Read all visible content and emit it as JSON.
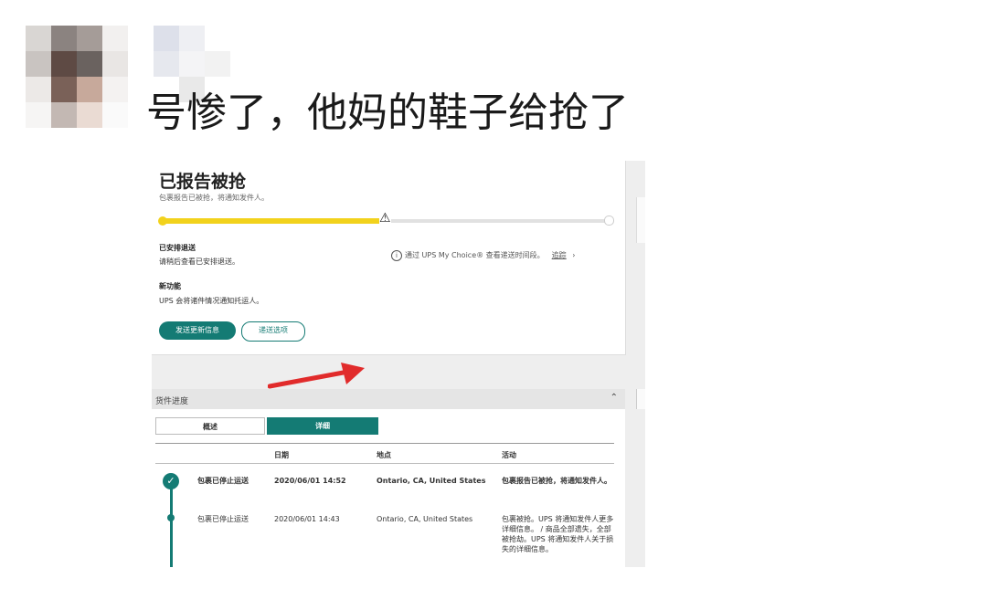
{
  "post": {
    "caption": "号惨了，他妈的鞋子给抢了"
  },
  "colors": {
    "accent": "#147b74",
    "progress": "#f2d21c",
    "arrow": "#e12b2b"
  },
  "screenshot": {
    "status_title": "已报告被抢",
    "status_sub": "包裹报告已被抢，将通知发件人。",
    "progress_fraction": 0.5,
    "progress_icon": "warning-triangle-icon",
    "warning_glyph": "⚠",
    "label1_title": "已安排退送",
    "label1_text": "请稍后查看已安排退送。",
    "label2_title": "新功能",
    "label2_text": "UPS 会将诸件情况通知托运人。",
    "info_text": "通过 UPS My Choice® 查看递送时间段。",
    "info_glyph": "i",
    "info_more": "追踪",
    "info_chevron": "›",
    "btn_primary": "发送更新信息",
    "btn_secondary": "递送选项",
    "section_title": "货件进度",
    "section_caret": "⌃",
    "tab_overview": "概述",
    "tab_details": "详细",
    "table_headers": [
      "日期",
      "地点",
      "活动"
    ],
    "rows": [
      {
        "status": "包裹已停止运送",
        "date": "2020/06/01  14:52",
        "location": "Ontario, CA, United States",
        "activity": "包裹报告已被抢，将通知发件人。"
      },
      {
        "status": "包裹已停止运送",
        "date": "2020/06/01  14:43",
        "location": "Ontario, CA, United States",
        "activity": "包裹被抢。UPS 将通知发件人更多详细信息。 / 商品全部遗失，全部被抢劫。UPS 将通知发件人关于损失的详细信息。"
      }
    ],
    "check_glyph": "✓"
  }
}
